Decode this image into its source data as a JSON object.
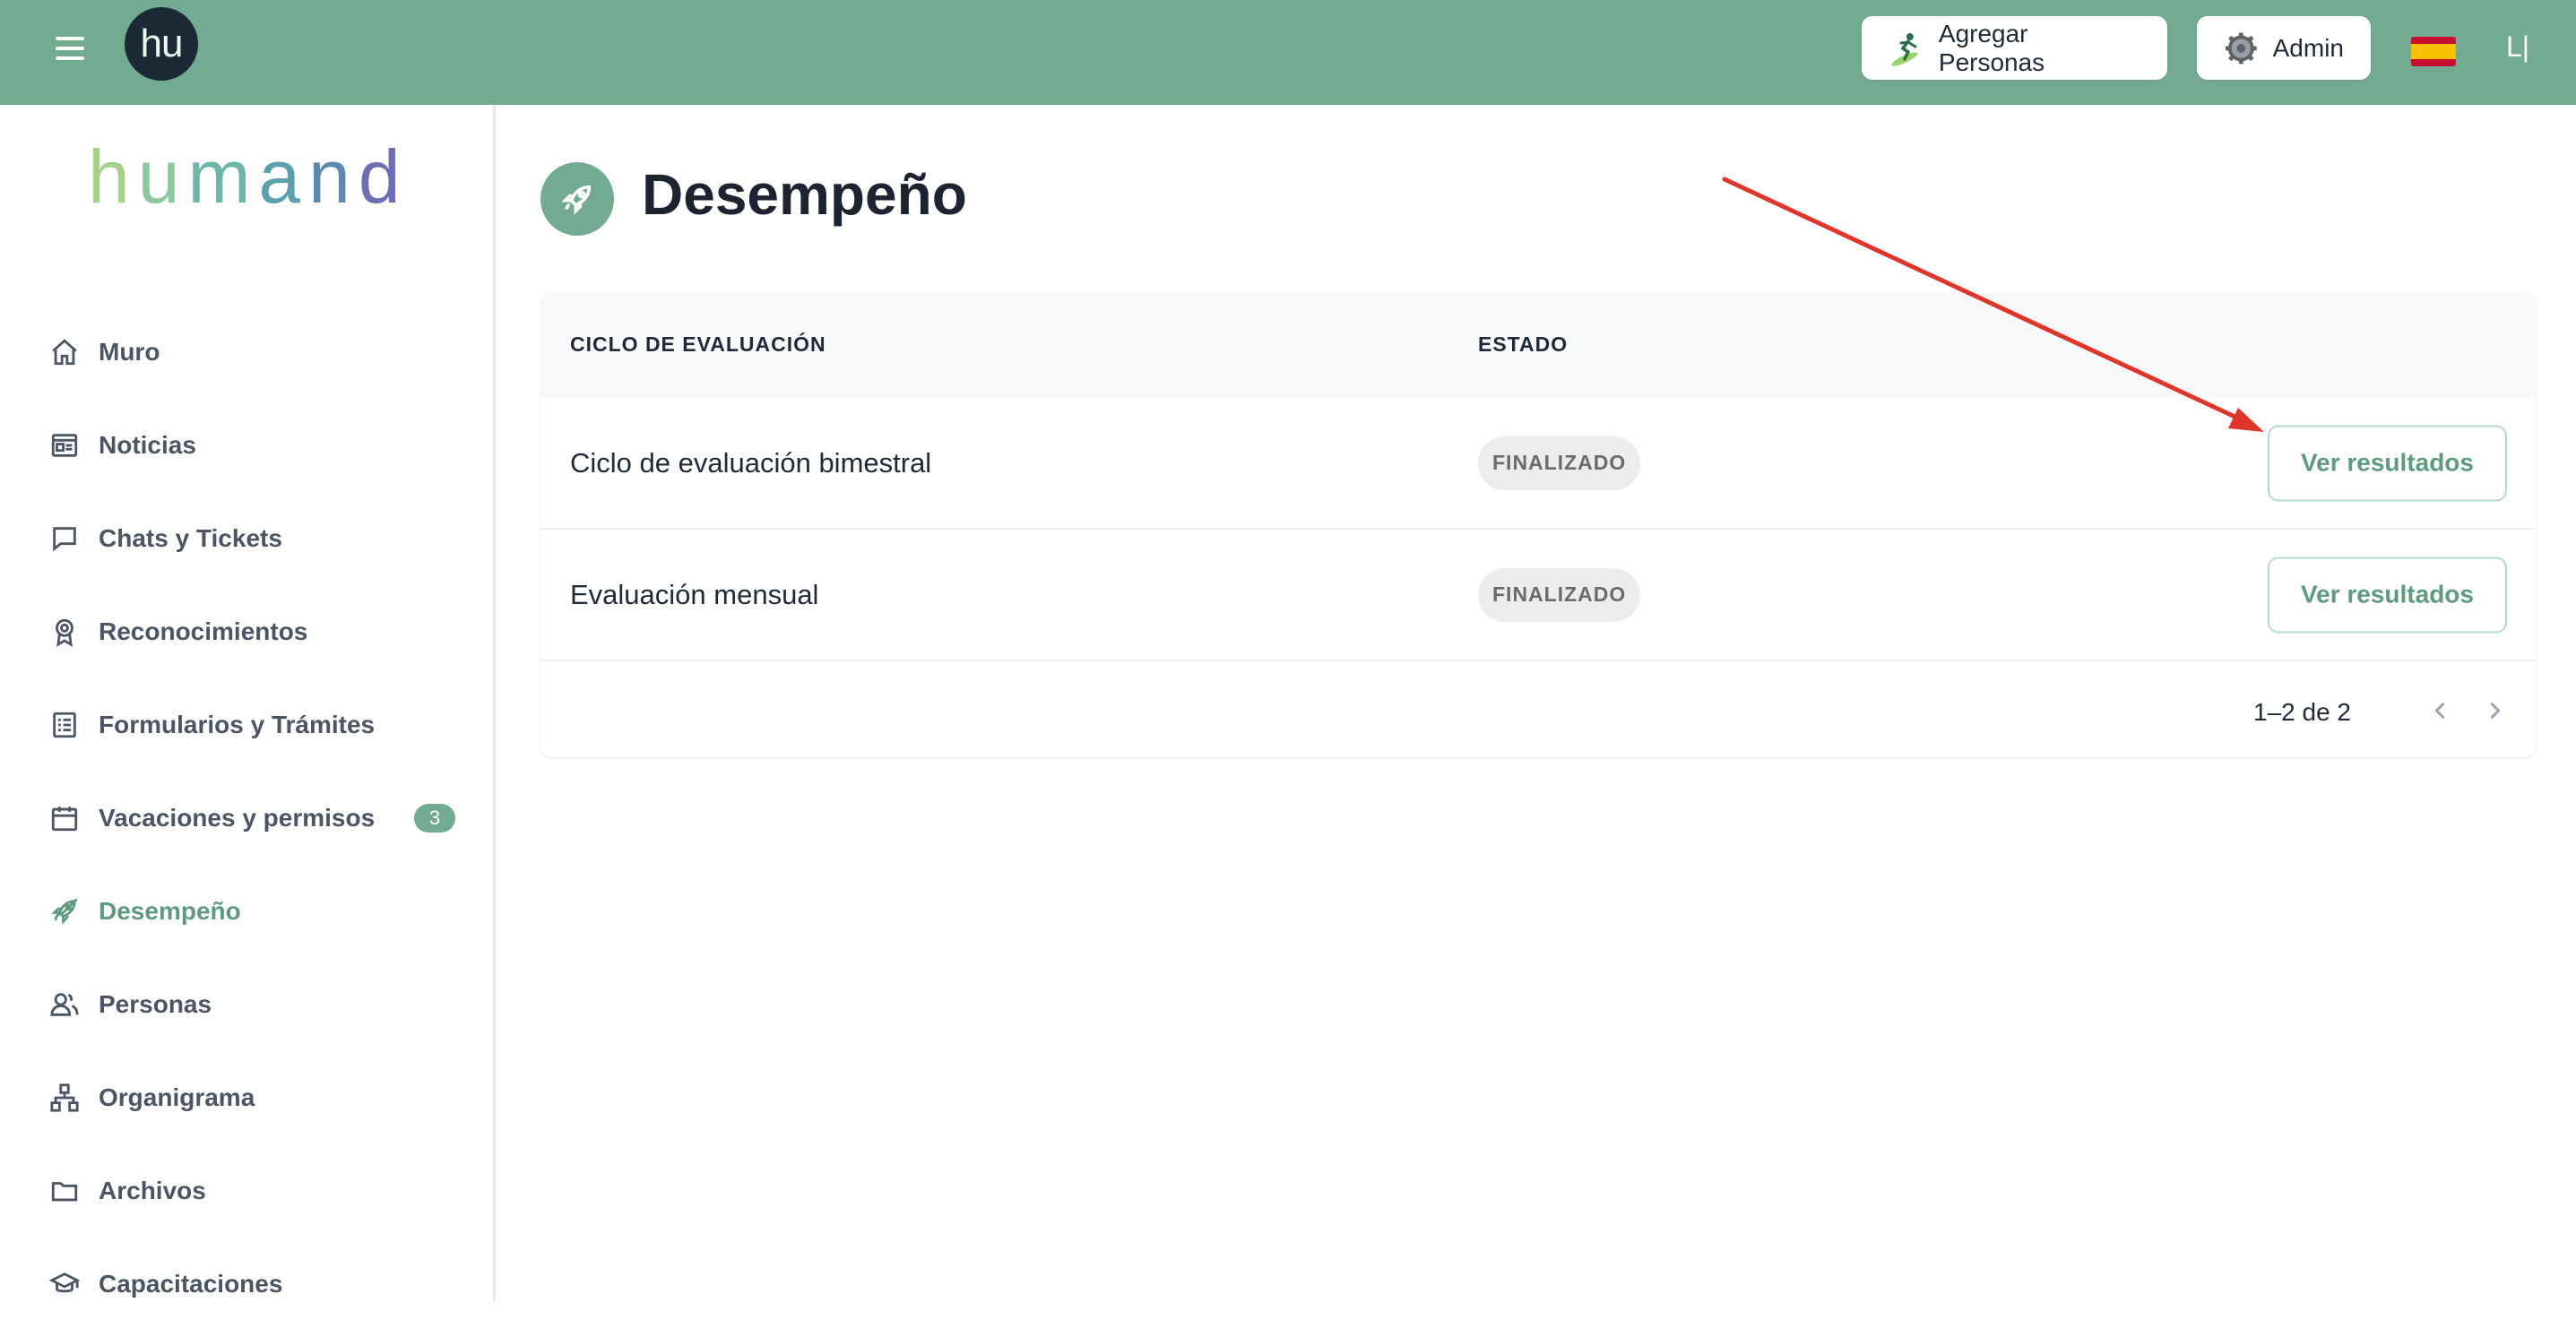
{
  "topbar": {
    "avatar_text": "hu",
    "add_people_label": "Agregar Personas",
    "admin_label": "Admin",
    "user_initials": "L|"
  },
  "sidebar": {
    "logo_letters": [
      "h",
      "u",
      "m",
      "a",
      "n",
      "d"
    ],
    "items": [
      {
        "label": "Muro",
        "icon": "home-icon"
      },
      {
        "label": "Noticias",
        "icon": "newspaper-icon"
      },
      {
        "label": "Chats y Tickets",
        "icon": "chat-icon"
      },
      {
        "label": "Reconocimientos",
        "icon": "award-icon"
      },
      {
        "label": "Formularios y Trámites",
        "icon": "form-icon"
      },
      {
        "label": "Vacaciones y permisos",
        "icon": "calendar-icon",
        "badge": "3"
      },
      {
        "label": "Desempeño",
        "icon": "rocket-icon",
        "active": true
      },
      {
        "label": "Personas",
        "icon": "people-icon"
      },
      {
        "label": "Organigrama",
        "icon": "org-chart-icon"
      },
      {
        "label": "Archivos",
        "icon": "folder-icon"
      },
      {
        "label": "Capacitaciones",
        "icon": "graduation-cap-icon"
      }
    ]
  },
  "main": {
    "title": "Desempeño",
    "title_icon": "rocket-icon",
    "table": {
      "col_cycle": "CICLO DE EVALUACIÓN",
      "col_status": "ESTADO",
      "rows": [
        {
          "name": "Ciclo de evaluación bimestral",
          "status": "FINALIZADO",
          "action": "Ver resultados"
        },
        {
          "name": "Evaluación mensual",
          "status": "FINALIZADO",
          "action": "Ver resultados"
        }
      ],
      "pagination": "1–2 de 2"
    }
  },
  "colors": {
    "brand_green": "#73aa92",
    "annotation_arrow": "#e0352b"
  }
}
